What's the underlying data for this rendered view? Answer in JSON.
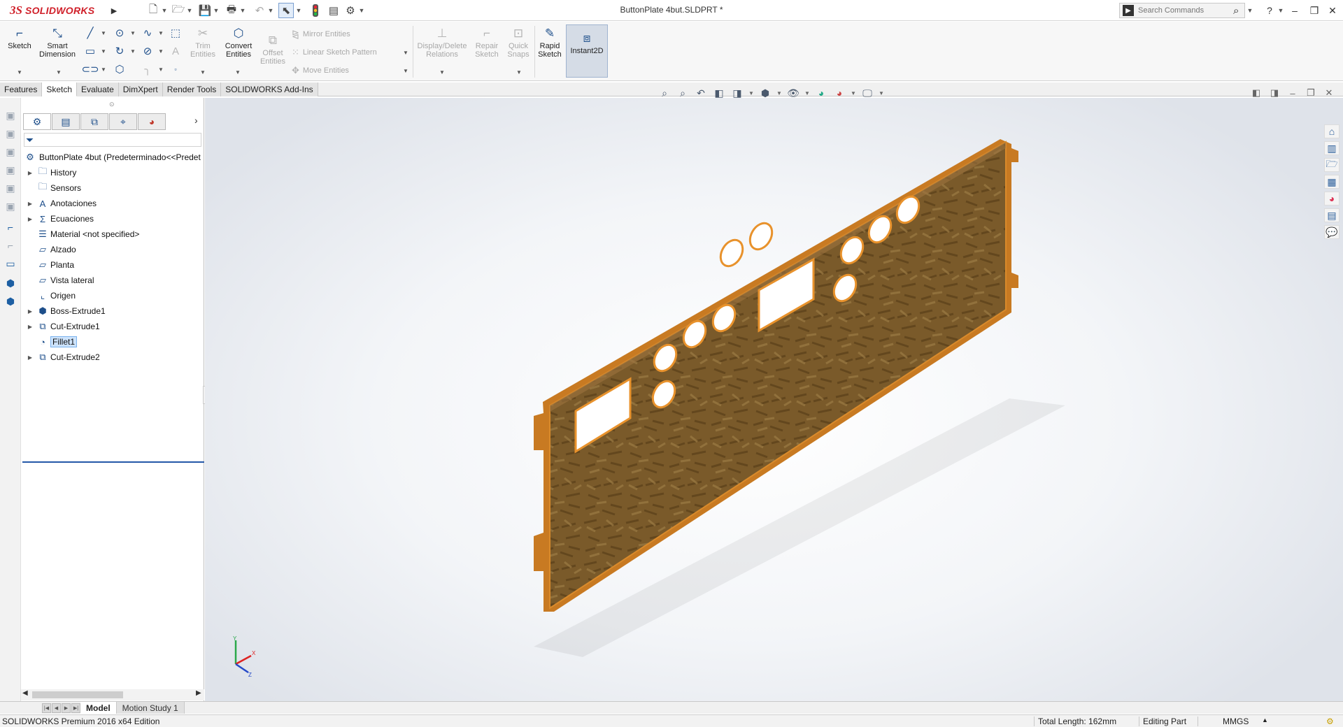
{
  "app": {
    "brand_prefix": "3S",
    "brand_name": "SOLIDWORKS",
    "window_title": "ButtonPlate 4but.SLDPRT *"
  },
  "quick_access": {
    "icons": [
      "new-document-icon",
      "open-folder-icon",
      "save-icon",
      "print-icon",
      "undo-icon",
      "select-arrow-icon",
      "rebuild-traffic-light-icon",
      "file-properties-icon",
      "options-gear-icon"
    ]
  },
  "search": {
    "placeholder": "Search Commands"
  },
  "window_controls": {
    "help": "?",
    "minimize": "–",
    "restore": "❐",
    "close": "✕"
  },
  "ribbon": {
    "sketch": "Sketch",
    "smart_dim_1": "Smart",
    "smart_dim_2": "Dimension",
    "trim_1": "Trim",
    "trim_2": "Entities",
    "convert_1": "Convert",
    "convert_2": "Entities",
    "offset_1": "Offset",
    "offset_2": "Entities",
    "mirror": "Mirror Entities",
    "linear_pattern": "Linear Sketch Pattern",
    "move": "Move Entities",
    "display_1": "Display/Delete",
    "display_2": "Relations",
    "repair_1": "Repair",
    "repair_2": "Sketch",
    "quick_1": "Quick",
    "quick_2": "Snaps",
    "rapid_1": "Rapid",
    "rapid_2": "Sketch",
    "instant2d": "Instant2D"
  },
  "command_tabs": [
    "Features",
    "Sketch",
    "Evaluate",
    "DimXpert",
    "Render Tools",
    "SOLIDWORKS Add-Ins"
  ],
  "feature_tree": {
    "root": "ButtonPlate 4but  (Predeterminado<<Predet",
    "items": [
      {
        "label": "History",
        "icon": "history-folder-icon",
        "expand": "▶"
      },
      {
        "label": "Sensors",
        "icon": "sensors-folder-icon",
        "expand": ""
      },
      {
        "label": "Anotaciones",
        "icon": "annotations-icon",
        "expand": "▶"
      },
      {
        "label": "Ecuaciones",
        "icon": "equations-icon",
        "expand": "▶"
      },
      {
        "label": "Material <not specified>",
        "icon": "material-icon",
        "expand": ""
      },
      {
        "label": "Alzado",
        "icon": "plane-icon",
        "expand": ""
      },
      {
        "label": "Planta",
        "icon": "plane-icon",
        "expand": ""
      },
      {
        "label": "Vista lateral",
        "icon": "plane-icon",
        "expand": ""
      },
      {
        "label": "Origen",
        "icon": "origin-icon",
        "expand": ""
      },
      {
        "label": "Boss-Extrude1",
        "icon": "boss-extrude-icon",
        "expand": "▶"
      },
      {
        "label": "Cut-Extrude1",
        "icon": "cut-extrude-icon",
        "expand": "▶"
      },
      {
        "label": "Fillet1",
        "icon": "fillet-icon",
        "expand": ""
      },
      {
        "label": "Cut-Extrude2",
        "icon": "cut-extrude-icon",
        "expand": "▶"
      }
    ]
  },
  "bottom_tabs": [
    "Model",
    "Motion Study 1"
  ],
  "status": {
    "edition": "SOLIDWORKS Premium 2016 x64 Edition",
    "length": "Total Length: 162mm",
    "mode": "Editing Part",
    "units": "MMGS",
    "units_caret": "▲"
  },
  "triad_labels": {
    "x": "X",
    "y": "Y",
    "z": "Z"
  }
}
